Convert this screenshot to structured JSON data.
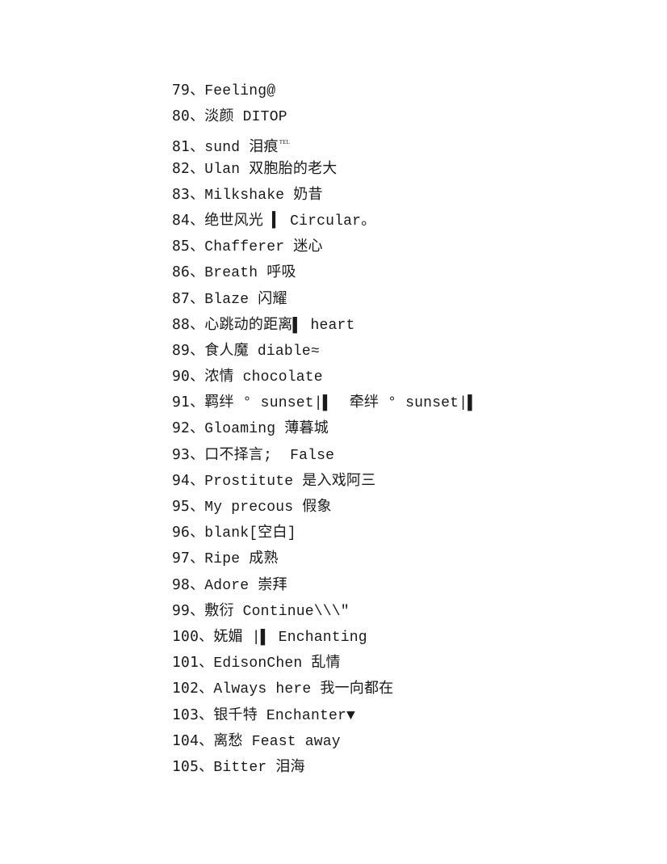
{
  "document": {
    "items": [
      {
        "number": "79",
        "separator": "、",
        "text": "Feeling@"
      },
      {
        "number": "80",
        "separator": "、",
        "text": "淡颜 DITOP"
      },
      {
        "number": "81",
        "separator": "、",
        "text": "sund 泪痕",
        "superscript": "TEL"
      },
      {
        "number": "82",
        "separator": "、",
        "text": "Ulan 双胞胎的老大"
      },
      {
        "number": "83",
        "separator": "、",
        "text": "Milkshake 奶昔"
      },
      {
        "number": "84",
        "separator": "、",
        "text": "绝世风光 ▍ Circular。"
      },
      {
        "number": "85",
        "separator": "、",
        "text": "Chafferer 迷心"
      },
      {
        "number": "86",
        "separator": "、",
        "text": "Breath 呼吸"
      },
      {
        "number": "87",
        "separator": "、",
        "text": "Blaze 闪耀"
      },
      {
        "number": "88",
        "separator": "、",
        "text": "心跳动的距离▌ heart"
      },
      {
        "number": "89",
        "separator": "、",
        "text": "食人魔 diable≈"
      },
      {
        "number": "90",
        "separator": "、",
        "text": "浓情 chocolate"
      },
      {
        "number": "91",
        "separator": "、",
        "text": "羁绊 ° sunset|▌  牵绊 ° sunset|▌"
      },
      {
        "number": "92",
        "separator": "、",
        "text": "Gloaming 薄暮城"
      },
      {
        "number": "93",
        "separator": "、",
        "text": "口不择言;  False"
      },
      {
        "number": "94",
        "separator": "、",
        "text": "Prostitute 是入戏阿三"
      },
      {
        "number": "95",
        "separator": "、",
        "text": "My precous 假象"
      },
      {
        "number": "96",
        "separator": "、",
        "text": "blank[空白]"
      },
      {
        "number": "97",
        "separator": "、",
        "text": "Ripe 成熟"
      },
      {
        "number": "98",
        "separator": "、",
        "text": "Adore 崇拜"
      },
      {
        "number": "99",
        "separator": "、",
        "text": "敷衍 Continue\\\\\\″"
      },
      {
        "number": "100",
        "separator": "、",
        "text": "妩媚 |▌ Enchanting"
      },
      {
        "number": "101",
        "separator": "、",
        "text": "EdisonChen 乱情"
      },
      {
        "number": "102",
        "separator": "、",
        "text": "Always here 我一向都在"
      },
      {
        "number": "103",
        "separator": "、",
        "text": "银千特 Enchanter▼"
      },
      {
        "number": "104",
        "separator": "、",
        "text": "离愁 Feast away"
      },
      {
        "number": "105",
        "separator": "、",
        "text": "Bitter 泪海"
      }
    ]
  }
}
